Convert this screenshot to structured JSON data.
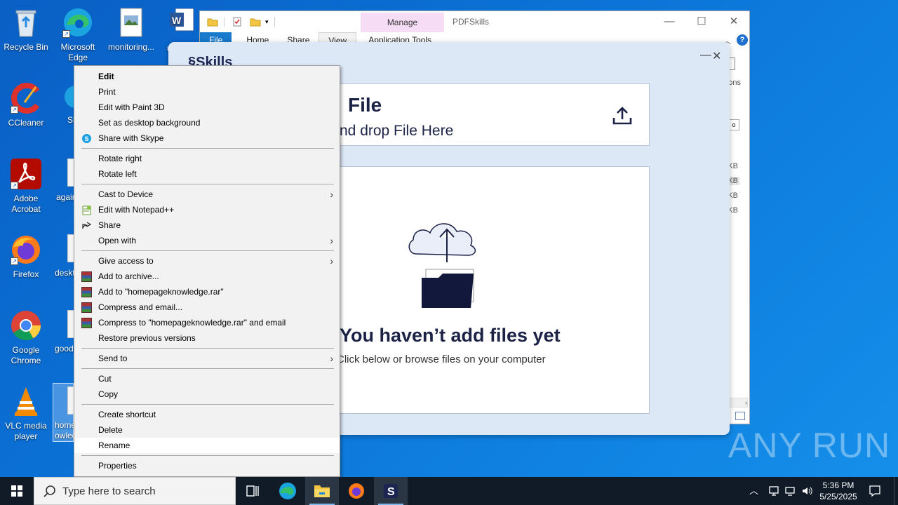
{
  "desktop": {
    "icons": [
      {
        "label": "Recycle Bin"
      },
      {
        "label": "Microsoft Edge"
      },
      {
        "label": "monitoring..."
      },
      {
        "label": "CCleaner"
      },
      {
        "label": "Adobe Acrobat"
      },
      {
        "label": "Firefox"
      },
      {
        "label": "Google Chrome"
      },
      {
        "label": "VLC media player"
      }
    ],
    "partial_labels": [
      "u",
      "Sk",
      "again",
      "deskt",
      "good",
      "home",
      "owled"
    ]
  },
  "explorer": {
    "manage_tab": "Manage",
    "title": "PDFSkills",
    "tabs": [
      "File",
      "Home",
      "Share",
      "View",
      "Application Tools"
    ],
    "side_text": "ons",
    "size_labels": [
      "KB",
      "KB",
      "KB",
      "KB"
    ]
  },
  "skills": {
    "logo": "Skills",
    "file_title": "File",
    "file_sub": "nd drop File Here",
    "empty_title": "You haven’t add files yet",
    "empty_sub": "Click below or browse files on your computer"
  },
  "context_menu": {
    "items": [
      {
        "label": "Edit"
      },
      {
        "label": "Print"
      },
      {
        "label": "Edit with Paint 3D"
      },
      {
        "label": "Set as desktop background"
      },
      {
        "label": "Share with Skype"
      },
      {
        "label": "Rotate right"
      },
      {
        "label": "Rotate left"
      },
      {
        "label": "Cast to Device"
      },
      {
        "label": "Edit with Notepad++"
      },
      {
        "label": "Share"
      },
      {
        "label": "Open with"
      },
      {
        "label": "Give access to"
      },
      {
        "label": "Add to archive..."
      },
      {
        "label": "Add to \"homepageknowledge.rar\""
      },
      {
        "label": "Compress and email..."
      },
      {
        "label": "Compress to \"homepageknowledge.rar\" and email"
      },
      {
        "label": "Restore previous versions"
      },
      {
        "label": "Send to"
      },
      {
        "label": "Cut"
      },
      {
        "label": "Copy"
      },
      {
        "label": "Create shortcut"
      },
      {
        "label": "Delete"
      },
      {
        "label": "Rename"
      },
      {
        "label": "Properties"
      }
    ]
  },
  "taskbar": {
    "search_placeholder": "Type here to search",
    "time": "5:36 PM",
    "date": "5/25/2025"
  },
  "watermark": "ANY RUN",
  "colors": {
    "desktop_bg": "#0b74d8",
    "taskbar_bg": "#101b27",
    "file_tab": "#1979ca",
    "manage_tab": "#f6dcf5",
    "skills_bg": "#dde8f7",
    "skills_text": "#1b2246"
  }
}
